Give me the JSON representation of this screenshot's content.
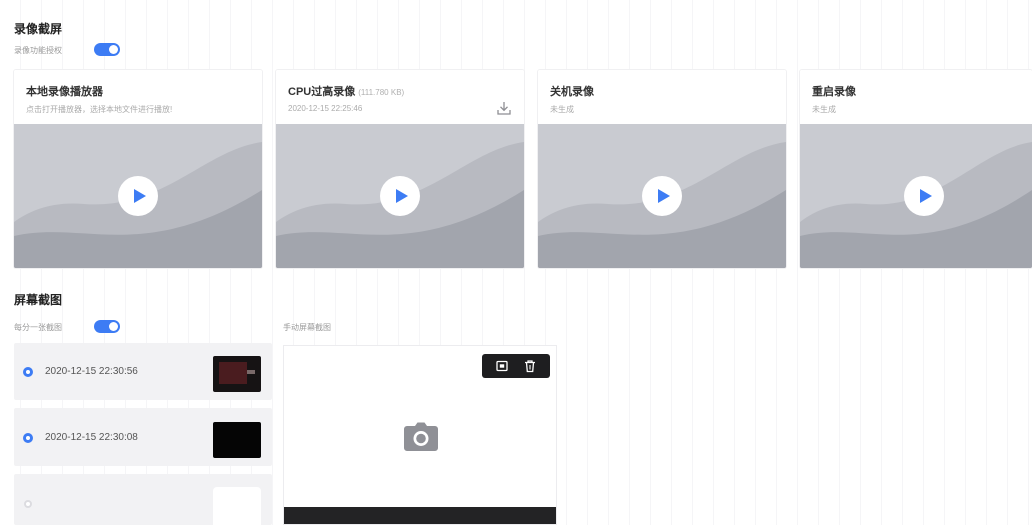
{
  "colors": {
    "accent": "#3d7cf4",
    "card_image_bg": "#b6b8bf",
    "list_item_bg": "#f2f2f4"
  },
  "recording": {
    "title": "录像截屏",
    "toggle_label": "录像功能授权",
    "toggle_on": true,
    "cards": [
      {
        "title": "本地录像播放器",
        "subtitle": "点击打开播放器，选择本地文件进行播放!",
        "play_icon": "play-icon"
      },
      {
        "title": "CPU过高录像",
        "meta": "(111.780 KB)",
        "subtitle": "2020-12-15 22:25:46",
        "download_icon": "download-icon",
        "play_icon": "play-icon"
      },
      {
        "title": "关机录像",
        "subtitle": "未生成",
        "play_icon": "play-icon"
      },
      {
        "title": "重启录像",
        "subtitle": "未生成",
        "play_icon": "play-icon"
      }
    ]
  },
  "screenshots": {
    "title": "屏幕截图",
    "toggle_label": "每分一张截图",
    "toggle_on": true,
    "items": [
      {
        "time": "2020-12-15 22:30:56",
        "selected": true
      },
      {
        "time": "2020-12-15 22:30:08",
        "selected": true
      },
      {
        "time": "",
        "selected": false
      }
    ],
    "manual": {
      "label": "手动屏幕截图",
      "tools": [
        "screenshot-icon",
        "trash-icon"
      ],
      "placeholder_icon": "camera-icon"
    }
  }
}
